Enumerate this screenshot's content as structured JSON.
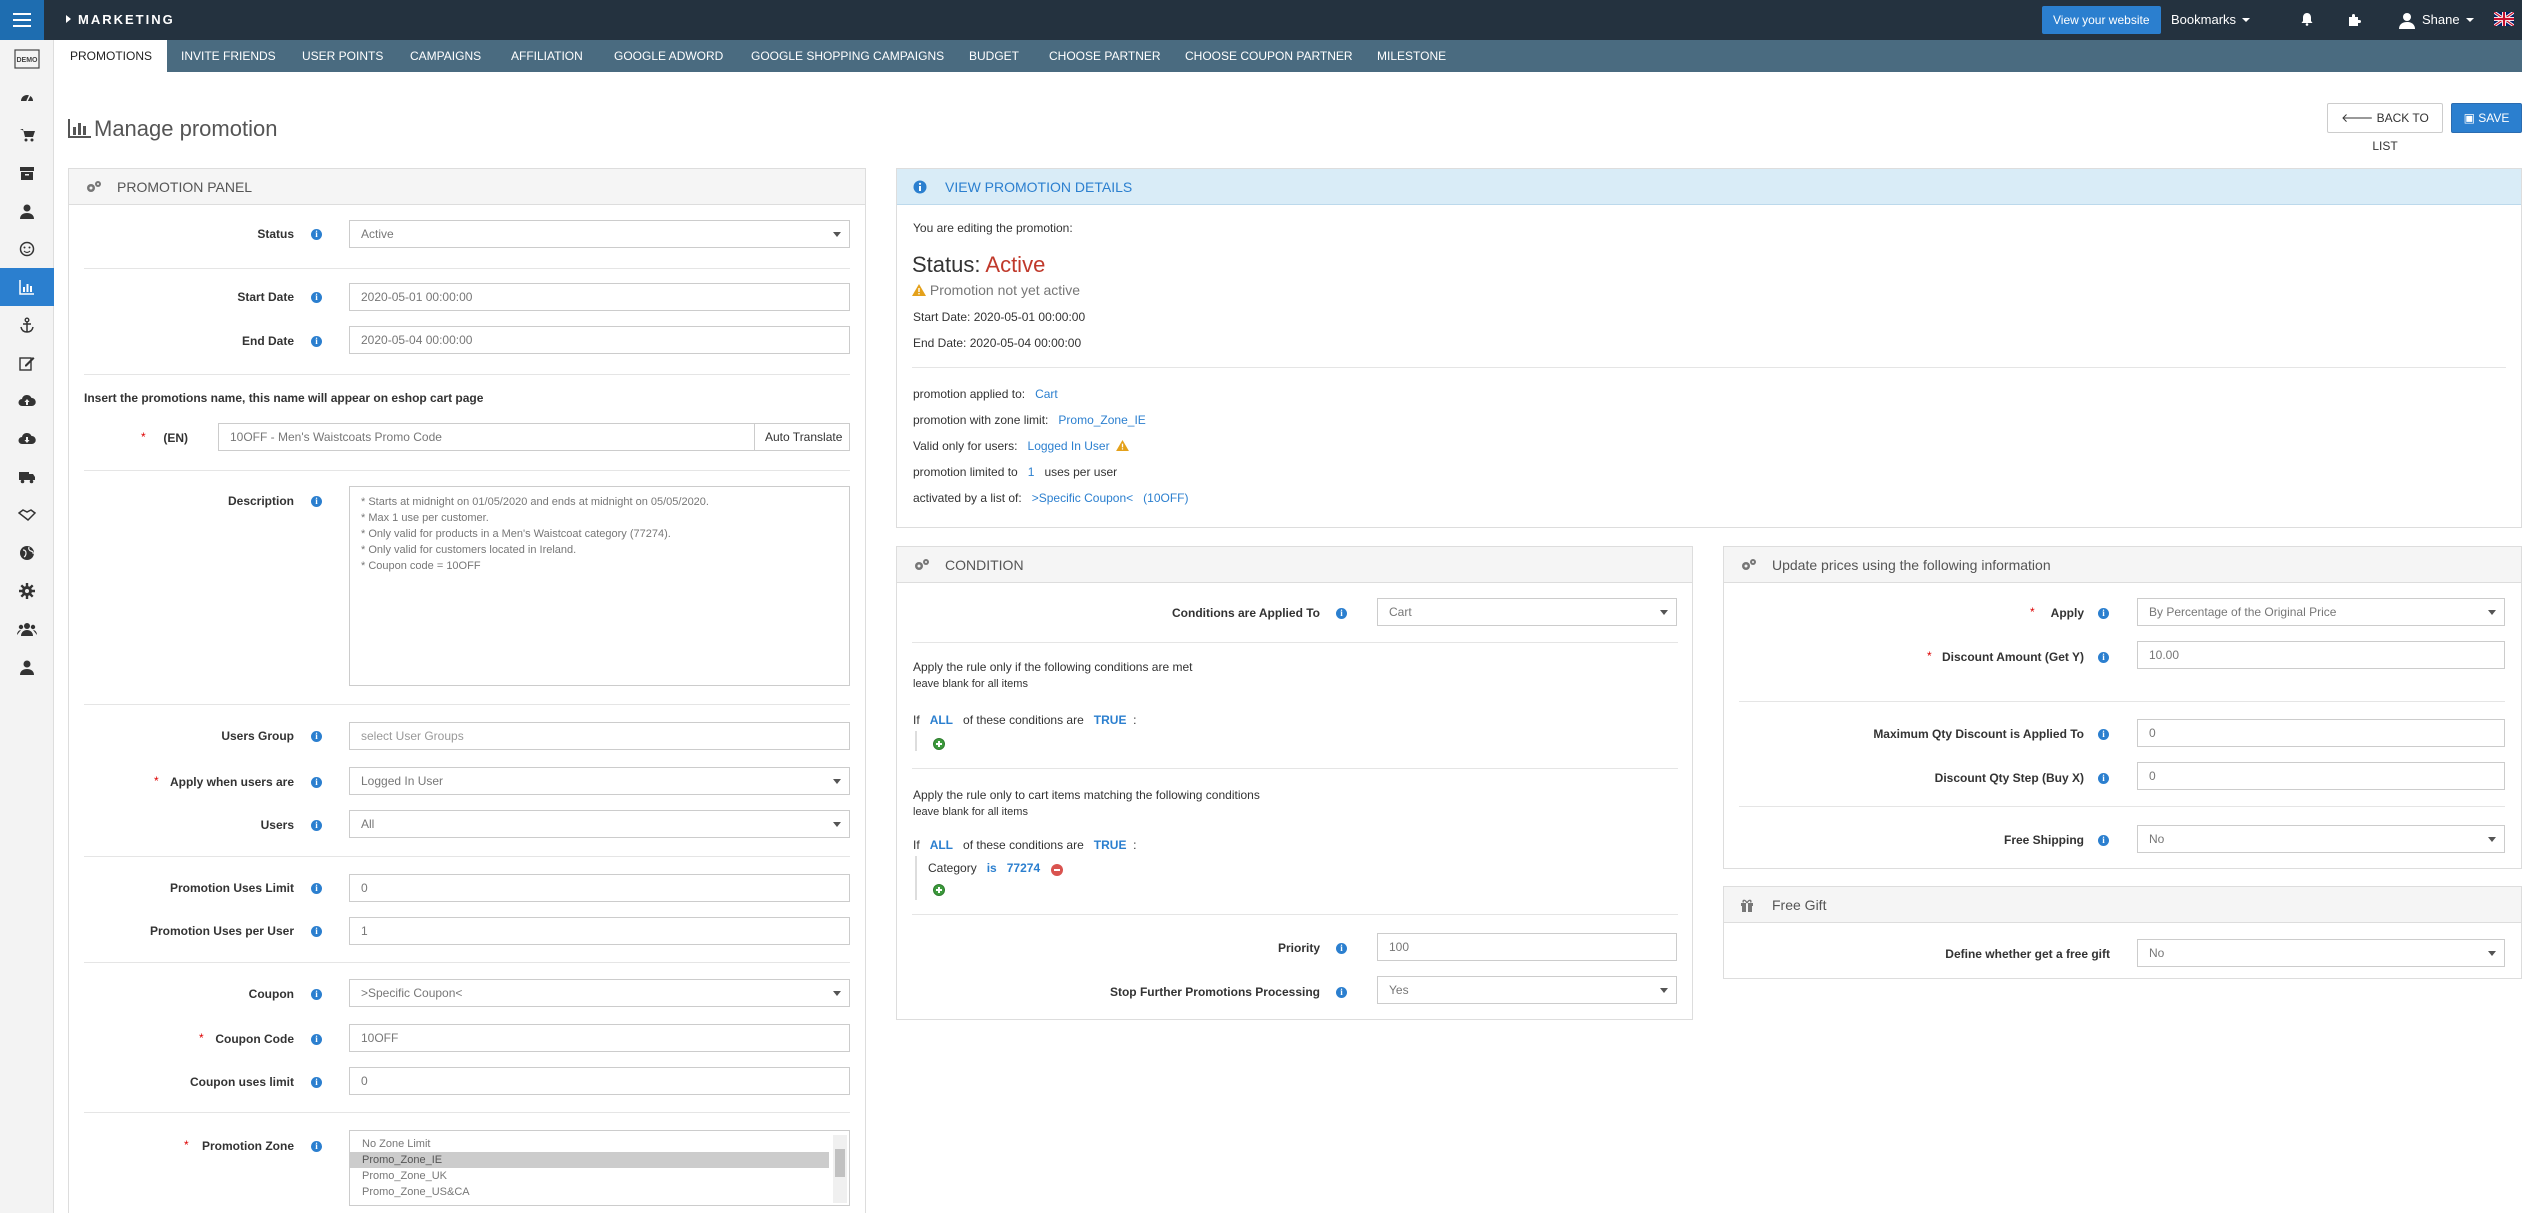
{
  "topbar": {
    "brand": "MARKETING",
    "view_website": "View your website",
    "bookmarks": "Bookmarks",
    "user": "Shane"
  },
  "sidebar": {
    "icons": [
      "demo-icon",
      "dashboard-icon",
      "cart-icon",
      "box-icon",
      "person-icon",
      "smiley-icon",
      "chart-icon",
      "anchor-icon",
      "edit-icon",
      "cloud-upload-icon",
      "cloud-download-icon",
      "truck-icon",
      "handshake-icon",
      "globe-icon",
      "gear-icon",
      "users-icon",
      "user-icon"
    ],
    "active": "chart-icon",
    "demo_label": "DEMO"
  },
  "tabs": [
    "PROMOTIONS",
    "INVITE FRIENDS",
    "USER POINTS",
    "CAMPAIGNS",
    "AFFILIATION",
    "GOOGLE ADWORD",
    "GOOGLE SHOPPING CAMPAIGNS",
    "BUDGET",
    "CHOOSE PARTNER",
    "CHOOSE COUPON PARTNER",
    "MILESTONE"
  ],
  "page": {
    "title": "Manage promotion",
    "back": "BACK TO LIST",
    "save": "SAVE"
  },
  "promo_panel": {
    "title": "PROMOTION PANEL",
    "status_label": "Status",
    "status_value": "Active",
    "start_label": "Start Date",
    "start_value": "2020-05-01 00:00:00",
    "end_label": "End Date",
    "end_value": "2020-05-04 00:00:00",
    "name_heading": "Insert the promotions name, this name will appear on eshop cart page",
    "lang_label": "(EN)",
    "name_value": "10OFF - Men's Waistcoats Promo Code",
    "auto_translate": "Auto Translate",
    "description_label": "Description",
    "description_lines": [
      "* Starts at midnight on 01/05/2020 and ends at midnight on 05/05/2020.",
      "* Max 1 use per customer.",
      "* Only valid for products in a Men's Waistcoat category (77274).",
      "* Only valid for customers located in Ireland.",
      "* Coupon code = 10OFF"
    ],
    "users_group_label": "Users Group",
    "users_group_placeholder": "select User Groups",
    "apply_when_label": "Apply when users are",
    "apply_when_value": "Logged In User",
    "users_label": "Users",
    "users_value": "All",
    "uses_limit_label": "Promotion Uses Limit",
    "uses_limit_value": "0",
    "uses_per_user_label": "Promotion Uses per User",
    "uses_per_user_value": "1",
    "coupon_label": "Coupon",
    "coupon_value": ">Specific Coupon<",
    "coupon_code_label": "Coupon Code",
    "coupon_code_value": "10OFF",
    "coupon_uses_label": "Coupon uses limit",
    "coupon_uses_value": "0",
    "zone_label": "Promotion Zone",
    "zone_options": [
      "No Zone Limit",
      "Promo_Zone_IE",
      "Promo_Zone_UK",
      "Promo_Zone_US&CA"
    ],
    "zone_selected": "Promo_Zone_IE"
  },
  "details": {
    "title": "VIEW PROMOTION DETAILS",
    "editing": "You are editing the promotion:",
    "status_prefix": "Status:",
    "status": "Active",
    "warning": "Promotion not yet active",
    "start": "Start Date: 2020-05-01 00:00:00",
    "end": "End Date: 2020-05-04 00:00:00",
    "applied_label": "promotion applied to:",
    "applied_value": "Cart",
    "zone_label": "promotion with zone limit:",
    "zone_value": "Promo_Zone_IE",
    "valid_label": "Valid only for users:",
    "valid_value": "Logged In User",
    "limited_label": "promotion limited to",
    "limited_value": "1",
    "limited_suffix": "uses per user",
    "activated_label": "activated by a list of:",
    "activated_value": ">Specific Coupon<",
    "activated_code": "(10OFF)"
  },
  "condition": {
    "title": "CONDITION",
    "applied_label": "Conditions are Applied To",
    "applied_value": "Cart",
    "rule1_title": "Apply the rule only if the following conditions are met",
    "rule1_sub": "leave blank for all items",
    "if": "If",
    "all": "ALL",
    "of_these": "of these conditions are",
    "true": "TRUE",
    "colon": ":",
    "rule2_title": "Apply the rule only to cart items matching the following conditions",
    "rule2_sub": "leave blank for all items",
    "cond_field": "Category",
    "cond_op": "is",
    "cond_value": "77274",
    "priority_label": "Priority",
    "priority_value": "100",
    "stop_label": "Stop Further Promotions Processing",
    "stop_value": "Yes"
  },
  "update_prices": {
    "title": "Update prices using the following information",
    "apply_label": "Apply",
    "apply_value": "By Percentage of the Original Price",
    "discount_label": "Discount Amount (Get Y)",
    "discount_value": "10.00",
    "maxqty_label": "Maximum Qty Discount is Applied To",
    "maxqty_value": "0",
    "step_label": "Discount Qty Step (Buy X)",
    "step_value": "0",
    "shipping_label": "Free Shipping",
    "shipping_value": "No"
  },
  "free_gift": {
    "title": "Free Gift",
    "define_label": "Define whether get a free gift",
    "define_value": "No"
  },
  "info_glyph": "i",
  "required_mark": "*"
}
